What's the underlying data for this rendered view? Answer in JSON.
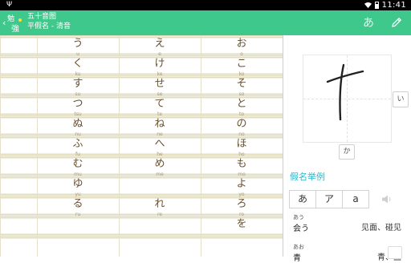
{
  "status_bar": {
    "time": "11:41",
    "usb_icon": "usb-icon",
    "wifi_icon": "wifi-icon",
    "battery_icon": "battery-icon"
  },
  "app_bar": {
    "logo_chars": [
      "勉",
      "強"
    ],
    "title": "五十音图",
    "subtitle": "平假名 - 清音",
    "kana_toggle_label": "あ",
    "edit_icon": "pencil-icon",
    "color": "#3ec88c"
  },
  "table": {
    "rows": [
      [
        {
          "kana": "う",
          "romaji": "u"
        },
        {
          "kana": "え",
          "romaji": "e"
        },
        {
          "kana": "お",
          "romaji": "o"
        }
      ],
      [
        {
          "kana": "く",
          "romaji": "ku"
        },
        {
          "kana": "け",
          "romaji": "ke"
        },
        {
          "kana": "こ",
          "romaji": "ko"
        }
      ],
      [
        {
          "kana": "す",
          "romaji": "su"
        },
        {
          "kana": "せ",
          "romaji": "se"
        },
        {
          "kana": "そ",
          "romaji": "so"
        }
      ],
      [
        {
          "kana": "つ",
          "romaji": "tsu"
        },
        {
          "kana": "て",
          "romaji": "te"
        },
        {
          "kana": "と",
          "romaji": "to"
        }
      ],
      [
        {
          "kana": "ぬ",
          "romaji": "nu"
        },
        {
          "kana": "ね",
          "romaji": "ne"
        },
        {
          "kana": "の",
          "romaji": "no"
        }
      ],
      [
        {
          "kana": "ふ",
          "romaji": "fu"
        },
        {
          "kana": "へ",
          "romaji": "he"
        },
        {
          "kana": "ほ",
          "romaji": "ho"
        }
      ],
      [
        {
          "kana": "む",
          "romaji": "mu"
        },
        {
          "kana": "め",
          "romaji": "me"
        },
        {
          "kana": "も",
          "romaji": "mo"
        }
      ],
      [
        {
          "kana": "ゆ",
          "romaji": "yu"
        },
        {
          "kana": "",
          "romaji": ""
        },
        {
          "kana": "よ",
          "romaji": "yo"
        }
      ],
      [
        {
          "kana": "る",
          "romaji": "ru"
        },
        {
          "kana": "れ",
          "romaji": "re"
        },
        {
          "kana": "ろ",
          "romaji": "ro"
        }
      ],
      [
        {
          "kana": "",
          "romaji": ""
        },
        {
          "kana": "",
          "romaji": ""
        },
        {
          "kana": "を",
          "romaji": ""
        }
      ]
    ]
  },
  "writing_panel": {
    "current_char": "な",
    "next_button": "い",
    "prev_button": "か",
    "examples_title": "假名举例",
    "segments": [
      "あ",
      "ア",
      "a"
    ],
    "speaker_icon": "speaker-icon",
    "examples": [
      {
        "furigana": "あう",
        "word": "会う",
        "meaning": "见面、碰见"
      },
      {
        "furigana": "あお",
        "word": "青",
        "meaning": "青、蓝"
      }
    ],
    "accent_color": "#2fb6c9"
  }
}
